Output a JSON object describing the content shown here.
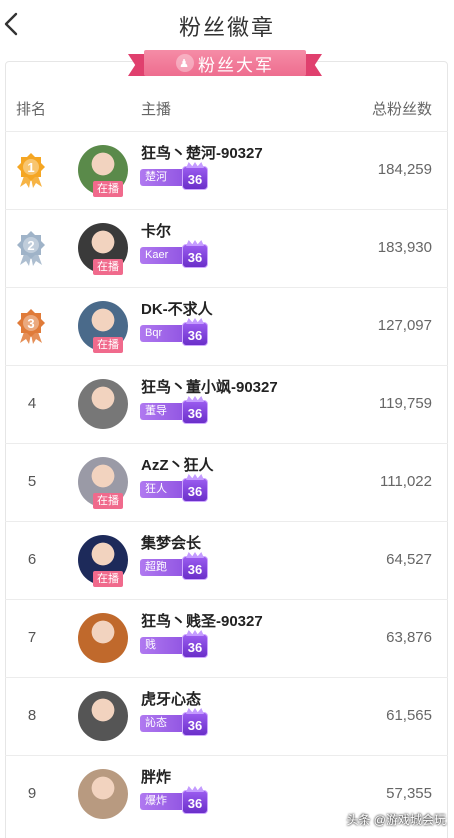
{
  "header": {
    "title": "粉丝徽章"
  },
  "banner": {
    "icon": "fan-army-icon",
    "text": "粉丝大军"
  },
  "columns": {
    "rank": "排名",
    "anchor": "主播",
    "fans": "总粉丝数"
  },
  "live_label": "在播",
  "rows": [
    {
      "rank": "1",
      "medal": "gold",
      "name": "狂鸟丶楚河-90327",
      "badge": "楚河",
      "level": "36",
      "live": true,
      "fans": "184,259",
      "avatar_color": "#5a8a4a"
    },
    {
      "rank": "2",
      "medal": "silver",
      "name": "卡尔",
      "badge": "Kaer",
      "level": "36",
      "live": true,
      "fans": "183,930",
      "avatar_color": "#3a3a3a"
    },
    {
      "rank": "3",
      "medal": "bronze",
      "name": "DK-不求人",
      "badge": "Bqr",
      "level": "36",
      "live": true,
      "fans": "127,097",
      "avatar_color": "#4a6a8a"
    },
    {
      "rank": "4",
      "medal": "",
      "name": "狂鸟丶董小飒-90327",
      "badge": "董导",
      "level": "36",
      "live": false,
      "fans": "119,759",
      "avatar_color": "#777"
    },
    {
      "rank": "5",
      "medal": "",
      "name": "AzZ丶狂人",
      "badge": "狂人",
      "level": "36",
      "live": true,
      "fans": "111,022",
      "avatar_color": "#9a9aa6"
    },
    {
      "rank": "6",
      "medal": "",
      "name": "集梦会长",
      "badge": "超跑",
      "level": "36",
      "live": true,
      "fans": "64,527",
      "avatar_color": "#1d2a5a"
    },
    {
      "rank": "7",
      "medal": "",
      "name": "狂鸟丶贱圣-90327",
      "badge": "贱",
      "level": "36",
      "live": false,
      "fans": "63,876",
      "avatar_color": "#c0692c"
    },
    {
      "rank": "8",
      "medal": "",
      "name": "虎牙心态",
      "badge": "訫态",
      "level": "36",
      "live": false,
      "fans": "61,565",
      "avatar_color": "#555"
    },
    {
      "rank": "9",
      "medal": "",
      "name": "胖炸",
      "badge": "爆炸",
      "level": "36",
      "live": false,
      "fans": "57,355",
      "avatar_color": "#b89a80"
    }
  ],
  "watermark": "头条 @游戏城会玩",
  "colors": {
    "accent": "#ee6d8f",
    "badge_purple": "#8c4fe0",
    "gold": "#f5a623",
    "silver": "#9fb3c8",
    "bronze": "#e07b39"
  }
}
